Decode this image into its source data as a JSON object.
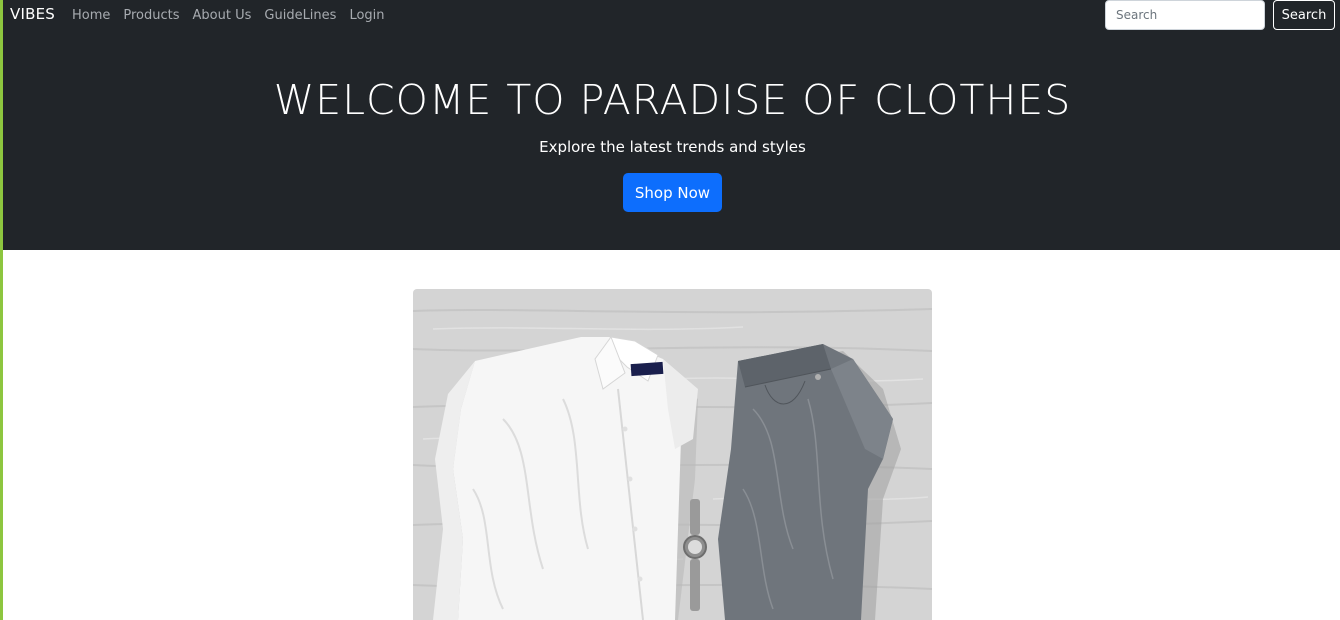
{
  "navbar": {
    "brand": "VIBES",
    "links": [
      "Home",
      "Products",
      "About Us",
      "GuideLines",
      "Login"
    ],
    "search_placeholder": "Search",
    "search_button": "Search"
  },
  "hero": {
    "title": "WELCOME TO PARADISE OF CLOTHES",
    "subtitle": "Explore the latest trends and styles",
    "cta": "Shop Now"
  },
  "colors": {
    "dark_background": "#212529",
    "primary_button": "#0d6efd",
    "left_accent": "#8dc63f"
  }
}
